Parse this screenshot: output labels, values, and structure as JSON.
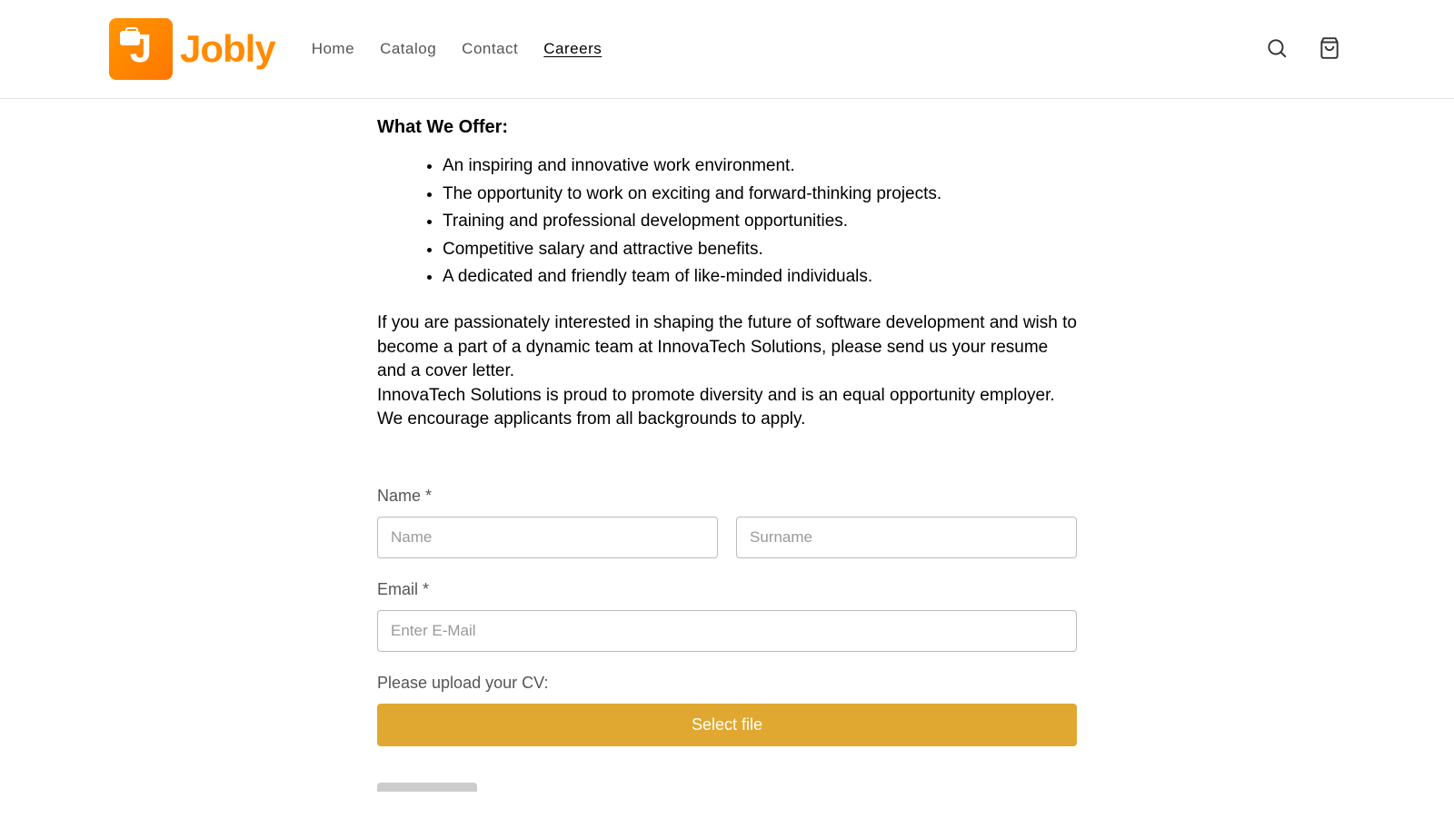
{
  "brand": {
    "name": "Jobly"
  },
  "nav": {
    "items": [
      {
        "label": "Home",
        "active": false
      },
      {
        "label": "Catalog",
        "active": false
      },
      {
        "label": "Contact",
        "active": false
      },
      {
        "label": "Careers",
        "active": true
      }
    ]
  },
  "content": {
    "offer_heading": "What We Offer:",
    "offer_items": [
      "An inspiring and innovative work environment.",
      "The opportunity to work on exciting and forward-thinking projects.",
      "Training and professional development opportunities.",
      "Competitive salary and attractive benefits.",
      "A dedicated and friendly team of like-minded individuals."
    ],
    "paragraph1": "If you are passionately interested in shaping the future of software development and wish to become a part of a dynamic team at InnovaTech Solutions, please send us your resume and a cover letter.",
    "paragraph2": "InnovaTech Solutions is proud to promote diversity and is an equal opportunity employer. We encourage applicants from all backgrounds to apply."
  },
  "form": {
    "name_label": "Name *",
    "name_placeholder": "Name",
    "surname_placeholder": "Surname",
    "email_label": "Email *",
    "email_placeholder": "Enter E-Mail",
    "upload_label": "Please upload your CV:",
    "upload_button": "Select file"
  }
}
